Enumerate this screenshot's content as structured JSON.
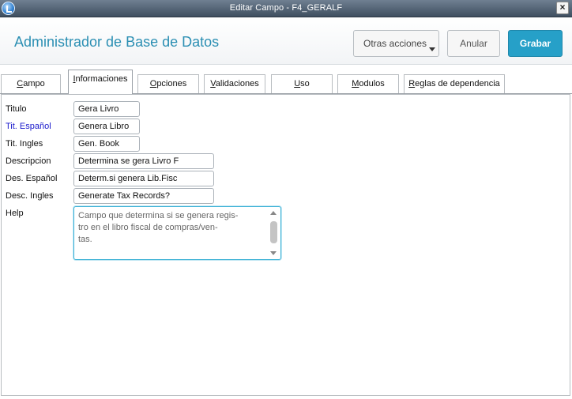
{
  "window": {
    "title": "Editar Campo - F4_GERALF",
    "close_label": "×"
  },
  "header": {
    "heading": "Administrador de Base de Datos",
    "otras_acciones": "Otras acciones",
    "anular": "Anular",
    "grabar": "Grabar"
  },
  "tabs": [
    {
      "pre": "",
      "u": "C",
      "post": "ampo"
    },
    {
      "pre": "",
      "u": "I",
      "post": "nformaciones"
    },
    {
      "pre": "",
      "u": "O",
      "post": "pciones"
    },
    {
      "pre": "",
      "u": "V",
      "post": "alidaciones"
    },
    {
      "pre": "",
      "u": "U",
      "post": "so"
    },
    {
      "pre": "",
      "u": "M",
      "post": "odulos"
    },
    {
      "pre": "",
      "u": "R",
      "post": "eglas de dependencia"
    }
  ],
  "form": {
    "titulo": {
      "label": "Titulo",
      "value": "Gera Livro"
    },
    "tit_espanol": {
      "label": "Tit. Español",
      "value": "Genera Libro"
    },
    "tit_ingles": {
      "label": "Tit. Ingles",
      "value": "Gen. Book"
    },
    "descripcion": {
      "label": "Descripcion",
      "value": "Determina se gera Livro F"
    },
    "des_espanol": {
      "label": "Des. Español",
      "value": "Determ.si genera Lib.Fisc"
    },
    "desc_ingles": {
      "label": "Desc. Ingles",
      "value": "Generate Tax Records?"
    },
    "help": {
      "label": "Help",
      "value": "Campo que determina si se genera regis-\ntro en el libro fiscal de compras/ven-\ntas."
    }
  },
  "colors": {
    "accent": "#26a0c8",
    "heading": "#2b8fb3",
    "mandatory_label": "#1a1acc"
  }
}
